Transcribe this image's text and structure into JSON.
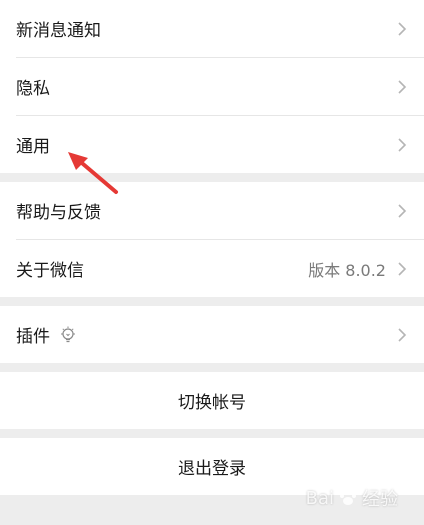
{
  "settings": {
    "new_message_notification": "新消息通知",
    "privacy": "隐私",
    "general": "通用",
    "help_feedback": "帮助与反馈",
    "about_wechat": "关于微信",
    "version_text": "版本 8.0.2",
    "plugins": "插件",
    "switch_account": "切换帐号",
    "logout": "退出登录"
  },
  "icons": {
    "chevron": "chevron-right-icon",
    "plugin": "lightbulb-icon",
    "annotation_arrow": "red-arrow"
  },
  "colors": {
    "background": "#ededed",
    "row_background": "#ffffff",
    "annotation": "#e53935"
  }
}
